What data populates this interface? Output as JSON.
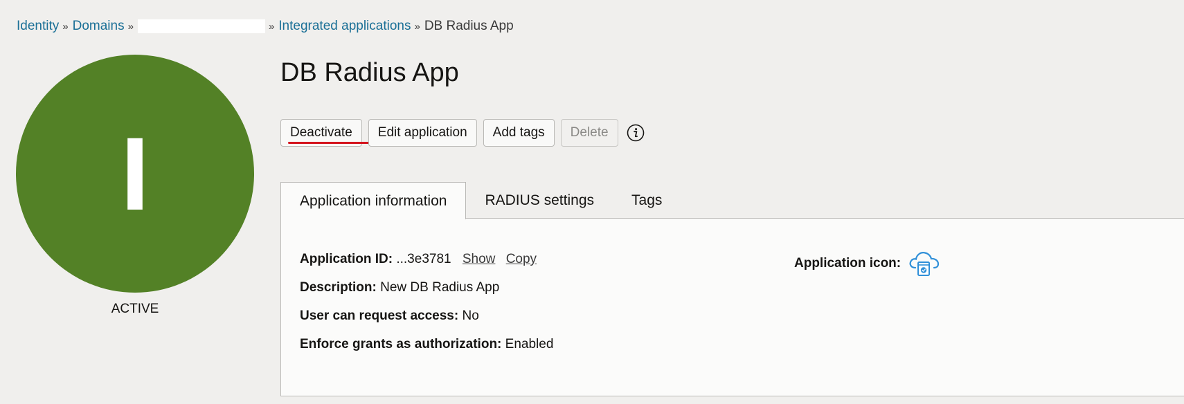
{
  "breadcrumb": {
    "identity": "Identity",
    "domains": "Domains",
    "integrated_applications": "Integrated applications",
    "current": "DB Radius App",
    "separator": "»"
  },
  "avatar": {
    "letter": "I",
    "color": "#538126"
  },
  "status": "ACTIVE",
  "title": "DB Radius App",
  "toolbar": {
    "deactivate": "Deactivate",
    "edit": "Edit application",
    "add_tags": "Add tags",
    "delete": "Delete",
    "info_icon": "info-icon"
  },
  "tabs": {
    "app_info": "Application information",
    "radius": "RADIUS settings",
    "tags": "Tags"
  },
  "details": {
    "app_id_label": "Application ID:",
    "app_id_value": "...3e3781",
    "show": "Show",
    "copy": "Copy",
    "description_label": "Description:",
    "description_value": "New DB Radius App",
    "request_access_label": "User can request access:",
    "request_access_value": "No",
    "grants_label": "Enforce grants as authorization:",
    "grants_value": "Enabled",
    "app_icon_label": "Application icon:",
    "app_icon": "cloud-app-icon"
  },
  "colors": {
    "link": "#1a6f96",
    "accent_underline": "#d4141d",
    "icon_blue": "#2f8fd8"
  }
}
